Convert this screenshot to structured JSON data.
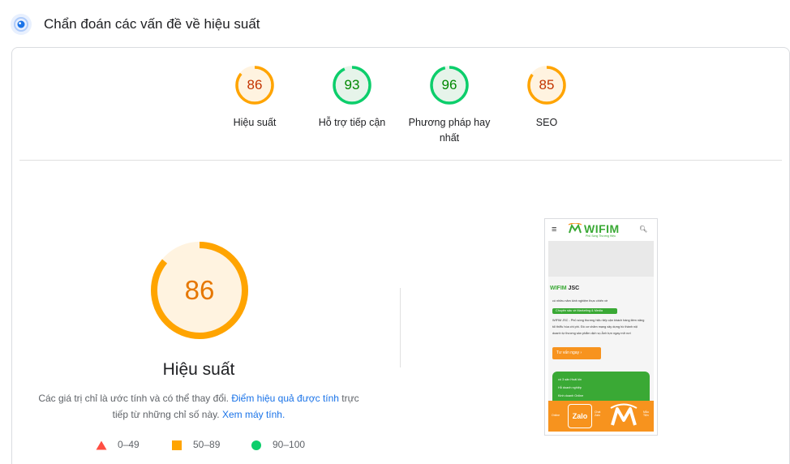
{
  "header": {
    "title": "Chẩn đoán các vấn đề về hiệu suất",
    "icon": "lighthouse-icon"
  },
  "categories": [
    {
      "score": "86",
      "label": "Hiệu suất",
      "level": 0.86,
      "color": "#ffa400",
      "text_color": "#c33300",
      "fill": "#fff3e0"
    },
    {
      "score": "93",
      "label": "Hỗ trợ tiếp cận",
      "level": 0.93,
      "color": "#0cce6b",
      "text_color": "#008800",
      "fill": "#e6f4ea"
    },
    {
      "score": "96",
      "label": "Phương pháp hay nhất",
      "level": 0.96,
      "color": "#0cce6b",
      "text_color": "#008800",
      "fill": "#e6f4ea"
    },
    {
      "score": "85",
      "label": "SEO",
      "level": 0.85,
      "color": "#ffa400",
      "text_color": "#c33300",
      "fill": "#fff3e0"
    }
  ],
  "main": {
    "score": "86",
    "level": 0.86,
    "title": "Hiệu suất",
    "desc_part1": "Các giá trị chỉ là ước tính và có thể thay đổi. ",
    "desc_link1": "Điểm hiệu quả được tính",
    "desc_part2": " trực tiếp từ những chỉ số này. ",
    "desc_link2": "Xem máy tính."
  },
  "legend": [
    {
      "range": "0–49",
      "shape": "triangle",
      "color": "#ff4e42"
    },
    {
      "range": "50–89",
      "shape": "square",
      "color": "#ffa400"
    },
    {
      "range": "90–100",
      "shape": "circle",
      "color": "#0cce6b"
    }
  ],
  "screenshot": {
    "menu": "≡",
    "logo": "WIFIM",
    "tagline": "Phủ Sóng Thương Hiệu",
    "title_green": "WIFIM",
    "title_rest": " JSC",
    "line1": "có nhiều năm kinh nghiệm thực chiến về",
    "pill": "Chuyên sâu về Marketing & Media",
    "para1": "WIFIM JSC - Phủ sóng thương hiệu tiếp cận khách hàng tiềm năng",
    "para2": "tối thiểu hóa chi phí. Đồ cơ chăm mạng xây dựng hồ thành nội",
    "para3": "doanh tự thương sản phẩm dịch vụ Ảnh tựn ngay mở nơi",
    "button": "Tư vấn ngay ›",
    "g1": "có 3 sản Hoái kin",
    "g2": "Hỗ doanh nghiệp",
    "g3": "Kinh doanh Online",
    "zalo": "Zalo",
    "f_left": "Online",
    "f_mid": "Chat\nZalo",
    "f_right": "Mẫu\nTiện"
  }
}
